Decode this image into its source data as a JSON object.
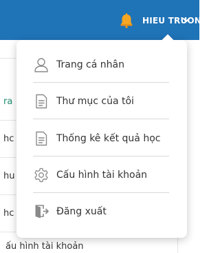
{
  "header": {
    "user_name": "HIEU TRUONG",
    "bell_icon": "bell-icon",
    "chevron_icon": "chevron-down-icon",
    "bar_color": "#1f73b7"
  },
  "background": {
    "rows": [
      {
        "label": "ra"
      },
      {
        "label": "hc"
      },
      {
        "label": "hu"
      },
      {
        "label": "hc"
      }
    ],
    "bottom_label": "ấu hình tài khoản"
  },
  "menu": {
    "items": [
      {
        "label": "Trang cá nhân",
        "icon": "user-icon"
      },
      {
        "label": "Thư mục của tôi",
        "icon": "document-icon"
      },
      {
        "label": "Thống kê kết quả học",
        "icon": "document-icon"
      },
      {
        "label": "Cấu hình tài khoản",
        "icon": "gear-icon"
      },
      {
        "label": "Đăng xuất",
        "icon": "logout-icon"
      }
    ]
  }
}
